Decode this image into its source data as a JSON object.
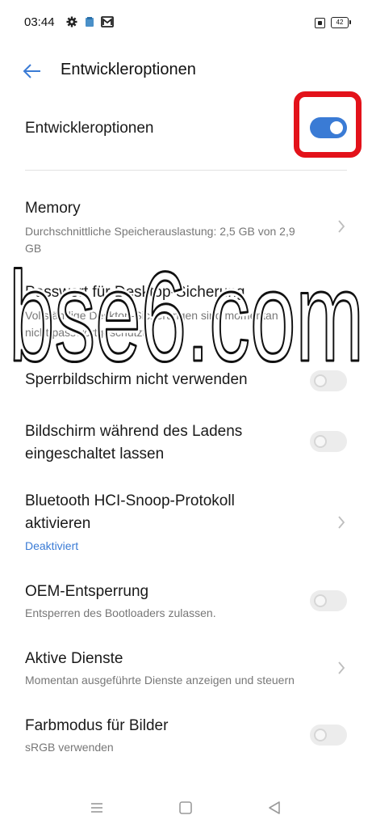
{
  "status_bar": {
    "time": "03:44",
    "icons": [
      "gear-icon",
      "app-notification-icon",
      "gmail-icon",
      "sim-icon"
    ],
    "battery": "42"
  },
  "header": {
    "title": "Entwickleroptionen",
    "back_icon": "arrow-left-icon"
  },
  "master_toggle": {
    "label": "Entwickleroptionen",
    "on": true,
    "highlight_color": "#e3121a"
  },
  "settings": [
    {
      "title": "Memory",
      "subtitle": "Durchschnittliche Speicherauslastung: 2,5 GB von 2,9 GB",
      "control": "chevron"
    },
    {
      "title": "Passwort für Desktop-Sicherung",
      "subtitle": "Vollständige Desktop-Sicherungen sind momentan nicht passwortgeschützt",
      "control": "none"
    },
    {
      "title": "Sperrbildschirm nicht verwenden",
      "subtitle": "",
      "control": "toggle",
      "on": false
    },
    {
      "title": "Bildschirm während des Ladens eingeschaltet lassen",
      "subtitle": "",
      "control": "toggle",
      "on": false
    },
    {
      "title": "Bluetooth HCI-Snoop-Protokoll aktivieren",
      "subtitle": "Deaktiviert",
      "subtitle_color": "#3a7bd5",
      "control": "chevron"
    },
    {
      "title": "OEM-Entsperrung",
      "subtitle": "Entsperren des Bootloaders zulassen.",
      "control": "toggle",
      "on": false
    },
    {
      "title": "Aktive Dienste",
      "subtitle": "Momentan ausgeführte Dienste anzeigen und steuern",
      "control": "chevron"
    },
    {
      "title": "Farbmodus für Bilder",
      "subtitle": "sRGB verwenden",
      "control": "toggle",
      "on": false
    }
  ],
  "watermark": {
    "text": "bse6.com"
  },
  "nav_bar": {
    "icons": [
      "menu-icon",
      "home-square-icon",
      "back-triangle-icon"
    ]
  },
  "colors": {
    "accent": "#3a7bd5",
    "highlight": "#e3121a"
  }
}
